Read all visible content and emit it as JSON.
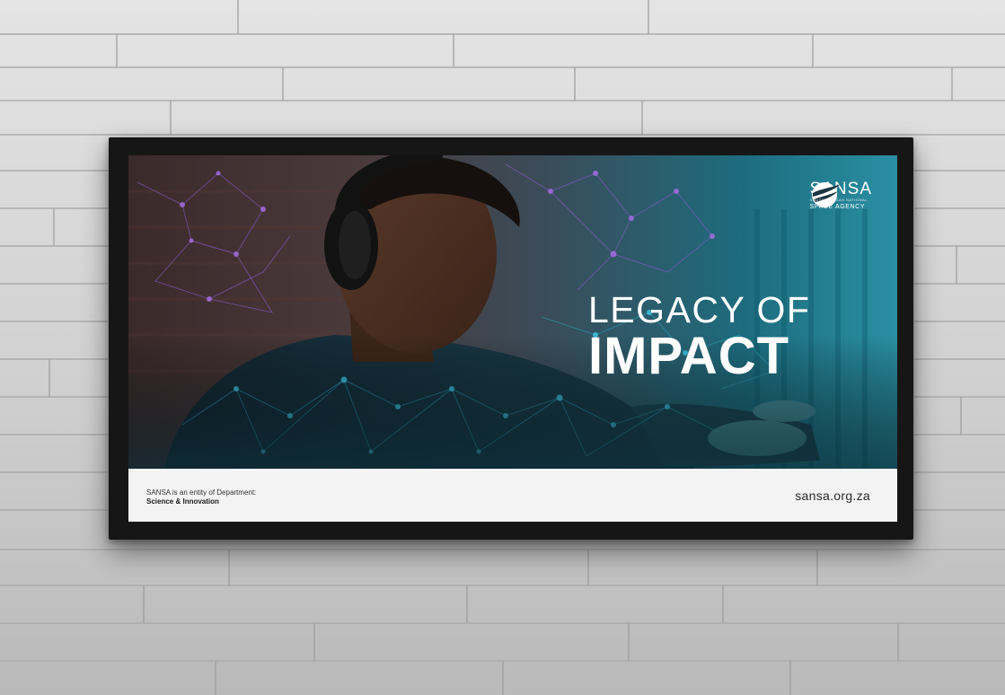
{
  "poster": {
    "brand": {
      "name": "SANSA",
      "subtitle": "SOUTH AFRICAN NATIONAL",
      "agency": "SPACE AGENCY"
    },
    "headline": {
      "line1": "LEGACY OF",
      "line2": "IMPACT"
    },
    "footer": {
      "entity_line1": "SANSA is an entity of Department:",
      "entity_line2": "Science & Innovation",
      "url": "sansa.org.za"
    }
  },
  "colors": {
    "wall": "#d6d6d6",
    "frame": "#161616",
    "teal": "#0fa3b8",
    "purple": "#8e4cc8",
    "footer": "#f3f3f4"
  }
}
